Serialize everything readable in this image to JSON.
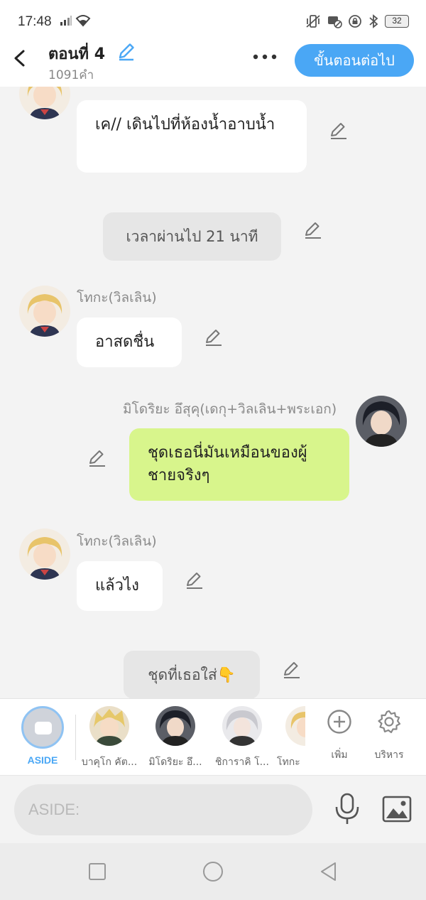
{
  "status_bar": {
    "time": "17:48",
    "battery": "32"
  },
  "header": {
    "title": "ตอนที่ 4",
    "word_count": "1091คำ",
    "next_label": "ขั้นตอนต่อไป"
  },
  "messages": {
    "m1_text": "เค// เดินไปที่ห้องน้ำอาบน้ำ",
    "narration1": "เวลาผ่านไป 21 นาที",
    "m2_sender": "โทกะ(วิลเลิน)",
    "m2_text": "อาสดชื่น",
    "m3_sender": "มิโดริยะ อึสุคุ(เดกุ+วิลเลิน+พระเอก)",
    "m3_text": "ชุดเธอนี่มันเหมือนของผู้ชายจริงๆ",
    "m4_sender": "โทกะ(วิลเลิน)",
    "m4_text": "แล้วไง",
    "narration2": "ชุดที่เธอใส่👇"
  },
  "character_bar": {
    "aside_label": "ASIDE",
    "characters": [
      {
        "name": "บาคุโก คัต..."
      },
      {
        "name": "มิโดริยะ อึ..."
      },
      {
        "name": "ชิการาคิ โ..."
      },
      {
        "name": "โทกะ"
      }
    ],
    "add_label": "เพิ่ม",
    "manage_label": "บริหาร"
  },
  "input": {
    "placeholder": "ASIDE:"
  },
  "colors": {
    "accent": "#4aa7f5",
    "protagonist_bubble": "#d8f58c",
    "background": "#f3f3f3"
  }
}
